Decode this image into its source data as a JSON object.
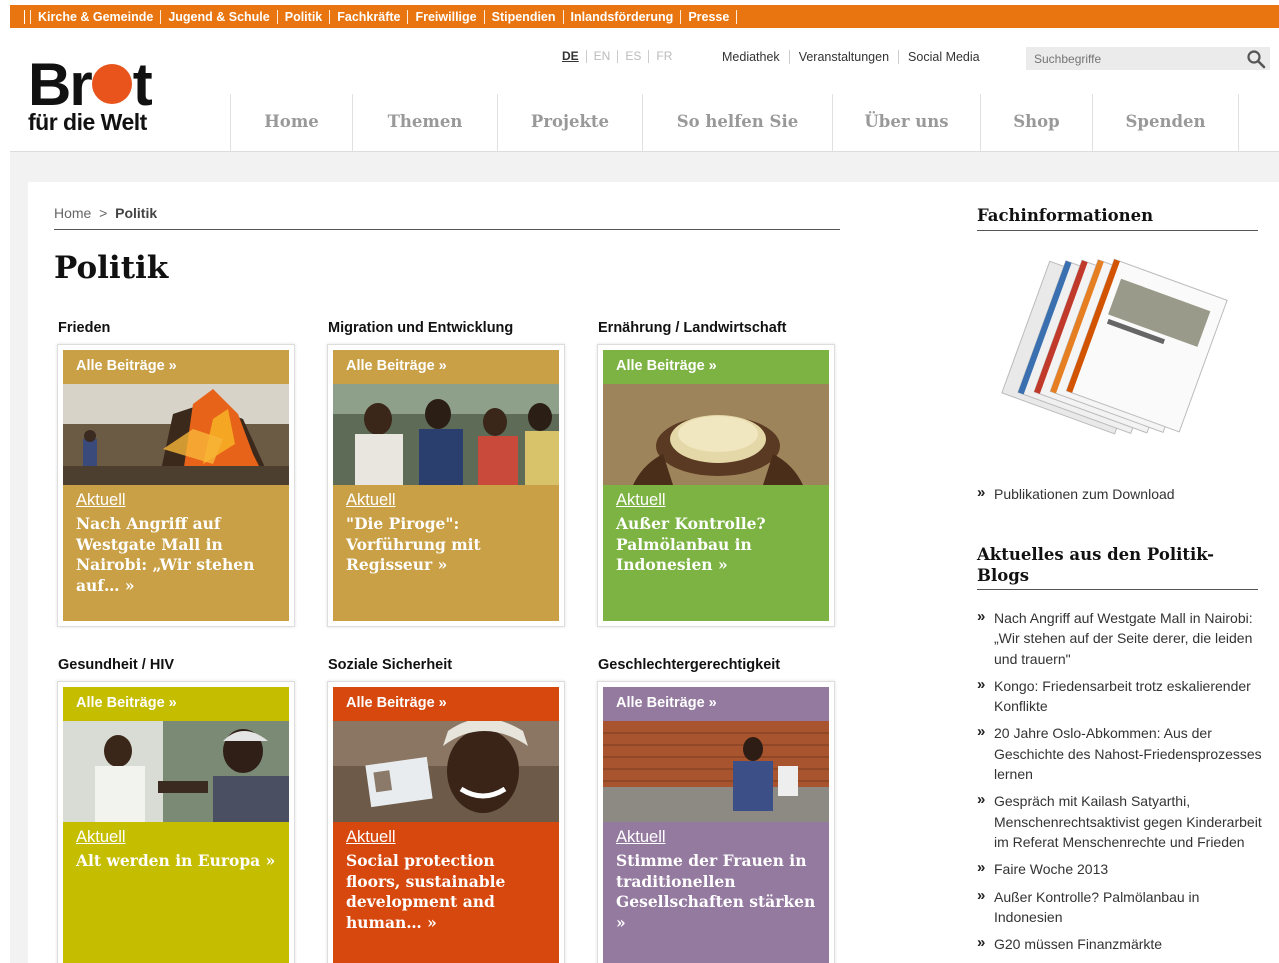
{
  "topnav": [
    "Kirche & Gemeinde",
    "Jugend & Schule",
    "Politik",
    "Fachkräfte",
    "Freiwillige",
    "Stipendien",
    "Inlandsförderung",
    "Presse"
  ],
  "logo": {
    "line1": "Brot",
    "line2": "für die Welt"
  },
  "languages": [
    "DE",
    "EN",
    "ES",
    "FR"
  ],
  "utility_links": [
    "Mediathek",
    "Veranstaltungen",
    "Social Media"
  ],
  "search": {
    "placeholder": "Suchbegriffe"
  },
  "mainnav": [
    "Home",
    "Themen",
    "Projekte",
    "So helfen Sie",
    "Über uns",
    "Shop",
    "Spenden"
  ],
  "breadcrumb": {
    "home": "Home",
    "sep": ">",
    "current": "Politik"
  },
  "page_title": "Politik",
  "categories": [
    {
      "title": "Frieden",
      "head": "Alle Beiträge »",
      "tag": "Aktuell",
      "text": "Nach Angriff auf Westgate Mall in Nairobi: „Wir stehen auf… »",
      "color": "#c9a046"
    },
    {
      "title": "Migration und Entwicklung",
      "head": "Alle Beiträge »",
      "tag": "Aktuell",
      "text": "\"Die Piroge\": Vorführung mit Regisseur »",
      "color": "#c9a046"
    },
    {
      "title": "Ernährung / Landwirtschaft",
      "head": "Alle Beiträge »",
      "tag": "Aktuell",
      "text": "Außer Kontrolle? Palmölanbau in Indonesien »",
      "color": "#7cb342"
    },
    {
      "title": "Gesundheit / HIV",
      "head": "Alle Beiträge »",
      "tag": "Aktuell",
      "text": "Alt werden in Europa »",
      "color": "#c5bd00"
    },
    {
      "title": "Soziale Sicherheit",
      "head": "Alle Beiträge »",
      "tag": "Aktuell",
      "text": "Social protection floors, sustainable development and human… »",
      "color": "#d7480e"
    },
    {
      "title": "Geschlechtergerechtigkeit",
      "head": "Alle Beiträge »",
      "tag": "Aktuell",
      "text": "Stimme der Frauen in traditionellen Gesellschaften stärken »",
      "color": "#957aa0"
    }
  ],
  "sidebar": {
    "fach_title": "Fachinformationen",
    "publ_link": "Publikationen zum Download",
    "blogs_title": "Aktuelles aus den Politik-Blogs",
    "blogs": [
      "Nach Angriff auf Westgate Mall in Nairobi: „Wir stehen auf der Seite derer, die leiden und trauern\"",
      "Kongo: Friedensarbeit trotz eskalierender Konflikte",
      "20 Jahre Oslo-Abkommen: Aus der Geschichte des Nahost-Friedensprozesses lernen",
      "Gespräch mit Kailash Satyarthi, Menschenrechtsaktivist gegen Kinderarbeit im Referat Menschenrechte und Frieden",
      "Faire Woche 2013",
      "Außer Kontrolle? Palmölanbau in Indonesien",
      "G20 müssen Finanzmärkte"
    ]
  },
  "colors": {
    "brand_orange": "#e8750f",
    "logo_red": "#e8541c"
  },
  "icons": {
    "search": "magnifier-icon",
    "list_bullet": "»"
  }
}
